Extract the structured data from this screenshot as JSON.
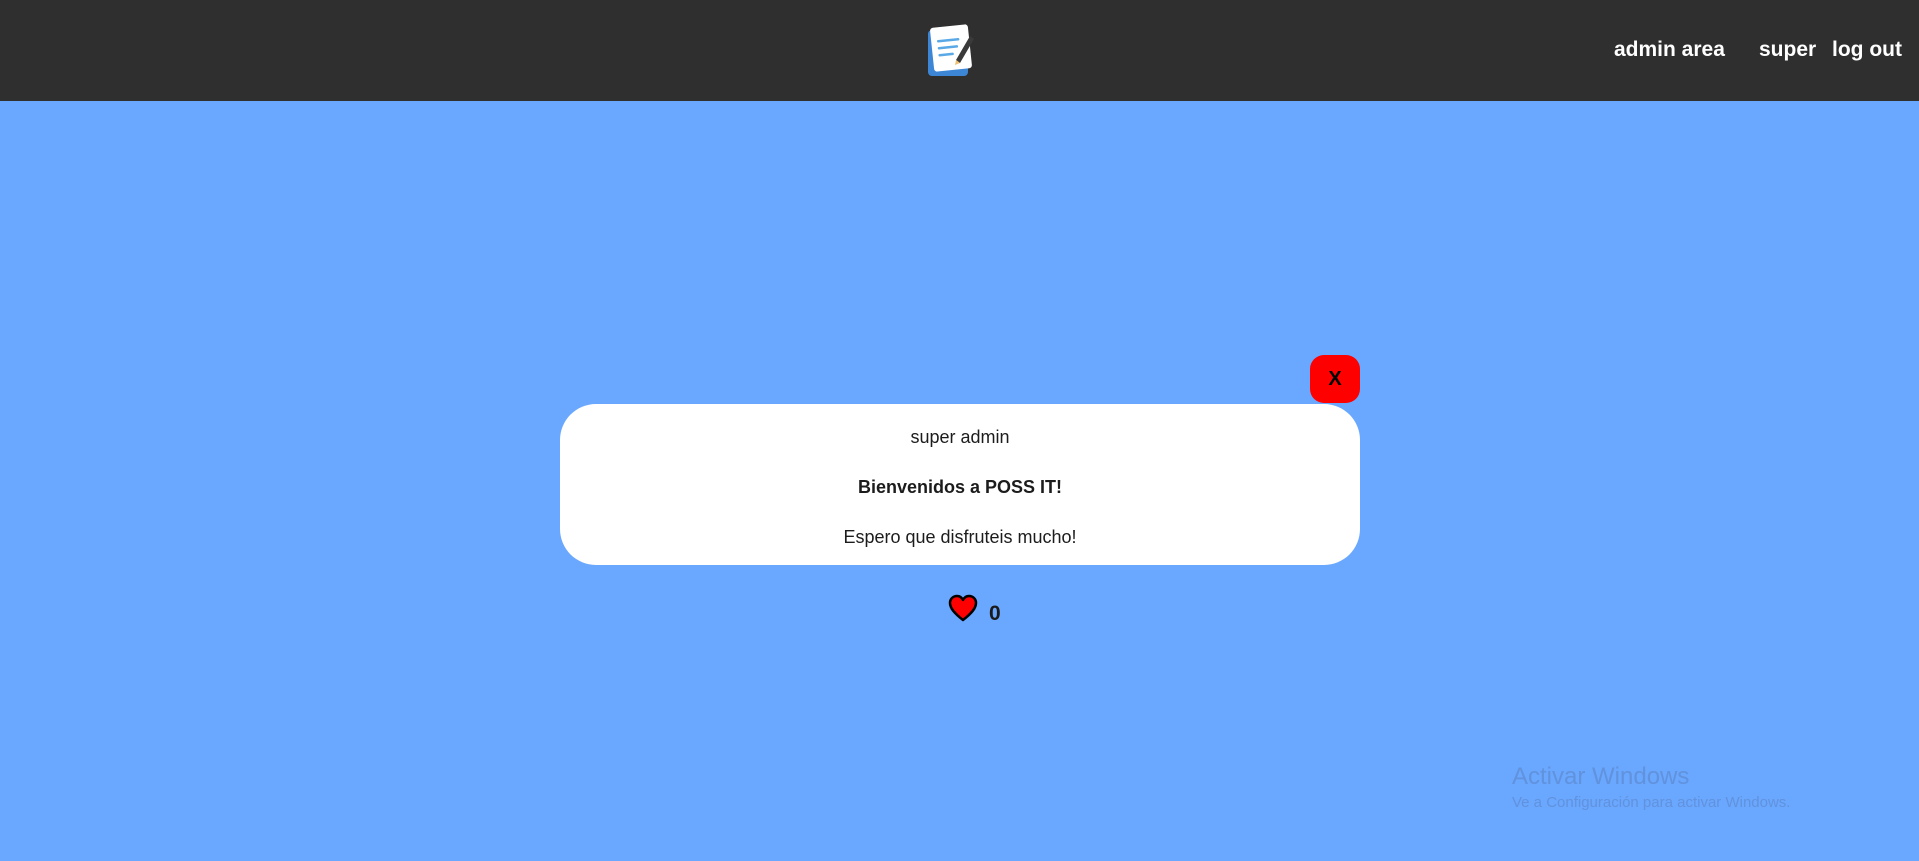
{
  "navbar": {
    "logo_icon": "notepad-pencil-icon",
    "admin_link": "admin area",
    "user_link": "super",
    "logout_link": "log out"
  },
  "post": {
    "close_label": "X",
    "author": "super admin",
    "title": "Bienvenidos a POSS IT!",
    "body": "Espero que disfruteis mucho!",
    "like_icon": "heart-icon",
    "like_count": "0"
  },
  "watermark": {
    "title": "Activar Windows",
    "subtitle": "Ve a Configuración para activar Windows."
  },
  "colors": {
    "navbar": "#2f2f2f",
    "background": "#6aa7fe",
    "close_button": "#ff0000",
    "heart": "#ff0000"
  }
}
